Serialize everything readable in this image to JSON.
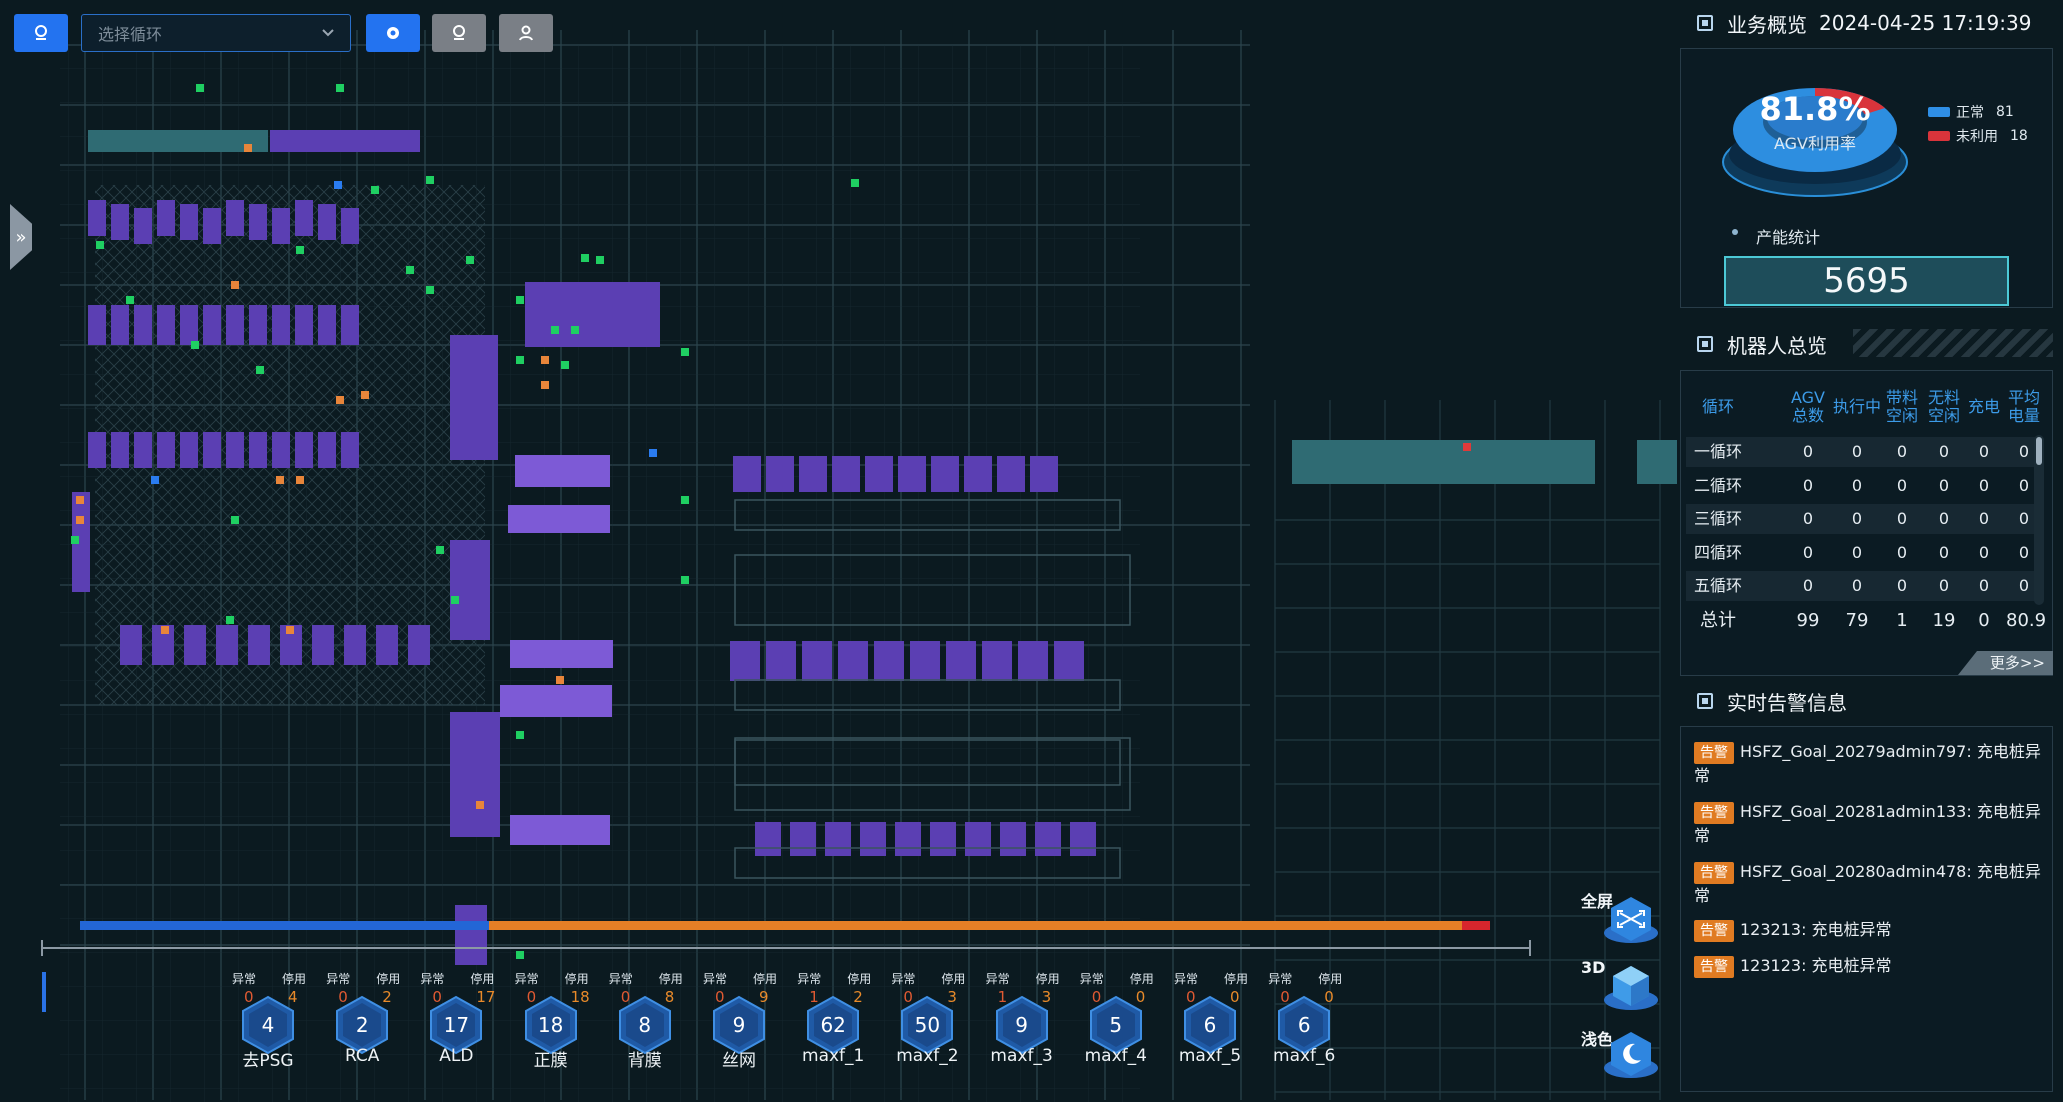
{
  "toolbar": {
    "select_placeholder": "选择循环",
    "buttons": [
      {
        "icon": "location-pin-icon",
        "style": "blue"
      },
      {
        "icon": "gear-icon",
        "style": "blue"
      },
      {
        "icon": "location-pin-outline-icon",
        "style": "gray"
      },
      {
        "icon": "user-icon",
        "style": "gray"
      }
    ]
  },
  "business": {
    "title": "业务概览",
    "datetime": "2024-04-25 17:19:39",
    "utilization_value": "81.8%",
    "utilization_label": "AGV利用率",
    "utilization_fraction": 0.818,
    "legend": [
      {
        "label": "正常",
        "value": "81",
        "color": "#2f8fe6"
      },
      {
        "label": "未利用",
        "value": "18",
        "color": "#d9343b"
      }
    ],
    "capacity_label": "产能统计",
    "capacity_value": "5695"
  },
  "robots": {
    "title": "机器人总览",
    "headers": [
      "循环",
      "AGV总数",
      "执行中",
      "带料空闲",
      "无料空闲",
      "充电",
      "平均电量"
    ],
    "rows": [
      [
        "一循环",
        "0",
        "0",
        "0",
        "0",
        "0",
        "0"
      ],
      [
        "二循环",
        "0",
        "0",
        "0",
        "0",
        "0",
        "0"
      ],
      [
        "三循环",
        "0",
        "0",
        "0",
        "0",
        "0",
        "0"
      ],
      [
        "四循环",
        "0",
        "0",
        "0",
        "0",
        "0",
        "0"
      ],
      [
        "五循环",
        "0",
        "0",
        "0",
        "0",
        "0",
        "0"
      ]
    ],
    "total": [
      "总计",
      "99",
      "79",
      "1",
      "19",
      "0",
      "80.9"
    ],
    "more": "更多>>"
  },
  "alarms": {
    "title": "实时告警信息",
    "tag": "告警",
    "items": [
      "HSFZ_Goal_20279admin797: 充电桩异常",
      "HSFZ_Goal_20281admin133: 充电桩异常",
      "HSFZ_Goal_20280admin478: 充电桩异常",
      "123213: 充电桩异常",
      "123123: 充电桩异常"
    ]
  },
  "status_bar": {
    "label_abnormal": "异常",
    "label_disabled": "停用",
    "stations": [
      {
        "name": "去PSG",
        "count": "4",
        "abnormal": "0",
        "disabled": "4"
      },
      {
        "name": "RCA",
        "count": "2",
        "abnormal": "0",
        "disabled": "2"
      },
      {
        "name": "ALD",
        "count": "17",
        "abnormal": "0",
        "disabled": "17"
      },
      {
        "name": "正膜",
        "count": "18",
        "abnormal": "0",
        "disabled": "18"
      },
      {
        "name": "背膜",
        "count": "8",
        "abnormal": "0",
        "disabled": "8"
      },
      {
        "name": "丝网",
        "count": "9",
        "abnormal": "0",
        "disabled": "9"
      },
      {
        "name": "maxf_1",
        "count": "62",
        "abnormal": "1",
        "disabled": "2"
      },
      {
        "name": "maxf_2",
        "count": "50",
        "abnormal": "0",
        "disabled": "3"
      },
      {
        "name": "maxf_3",
        "count": "9",
        "abnormal": "1",
        "disabled": "3"
      },
      {
        "name": "maxf_4",
        "count": "5",
        "abnormal": "0",
        "disabled": "0"
      },
      {
        "name": "maxf_5",
        "count": "6",
        "abnormal": "0",
        "disabled": "0"
      },
      {
        "name": "maxf_6",
        "count": "6",
        "abnormal": "0",
        "disabled": "0"
      }
    ],
    "progress": {
      "blue": 0.29,
      "orange": 0.69,
      "red": 0.02
    }
  },
  "controls": {
    "fullscreen": "全屏",
    "three_d": "3D",
    "light": "浅色"
  }
}
